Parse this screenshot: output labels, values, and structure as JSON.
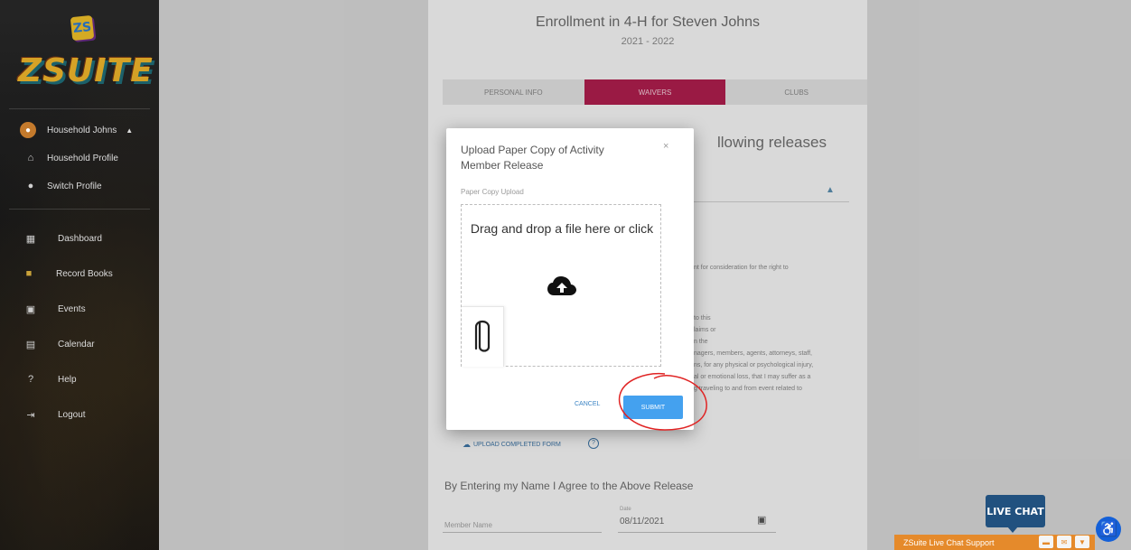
{
  "sidebar": {
    "brand": "ZSUITE",
    "badge": "ZS",
    "household": "Household Johns",
    "items": [
      {
        "label": "Household Profile"
      },
      {
        "label": "Switch Profile"
      },
      {
        "label": "Dashboard"
      },
      {
        "label": "Record Books"
      },
      {
        "label": "Events"
      },
      {
        "label": "Calendar"
      },
      {
        "label": "Help"
      },
      {
        "label": "Logout"
      }
    ]
  },
  "page": {
    "title": "Enrollment in 4-H for Steven Johns",
    "subtitle": "2021 - 2022",
    "tabs": [
      "PERSONAL INFO",
      "WAIVERS",
      "CLUBS"
    ],
    "active_tab": "WAIVERS",
    "section_heading_visible": "llowing releases",
    "release_text_lines": [
      "nt for consideration for the right to",
      "to this",
      "laims or",
      "n the",
      "nagers, members, agents, attorneys, staff,",
      "ns, for any physical or psychological injury,",
      "al or emotional loss, that I may suffer as a",
      "g traveling to and from event related to"
    ],
    "upload_completed_form": "UPLOAD COMPLETED FORM",
    "agree_heading": "By Entering my Name I Agree to the Above Release",
    "member_name_placeholder": "Member Name",
    "date_label": "Date",
    "date_value": "08/11/2021"
  },
  "modal": {
    "title": "Upload Paper Copy of Activity Member Release",
    "close_symbol": "×",
    "field_label": "Paper Copy Upload",
    "dropzone_text": "Drag and drop a file here or click",
    "cancel_label": "CANCEL",
    "submit_label": "SUBMIT"
  },
  "chat": {
    "badge": "LIVE CHAT",
    "bar_label": "ZSuite Live Chat Support"
  },
  "colors": {
    "accent_tab": "#b01e4e",
    "submit": "#44a1ef",
    "chat_bar": "#e58a2b",
    "chat_badge": "#21517f",
    "annotation": "#e02424"
  }
}
